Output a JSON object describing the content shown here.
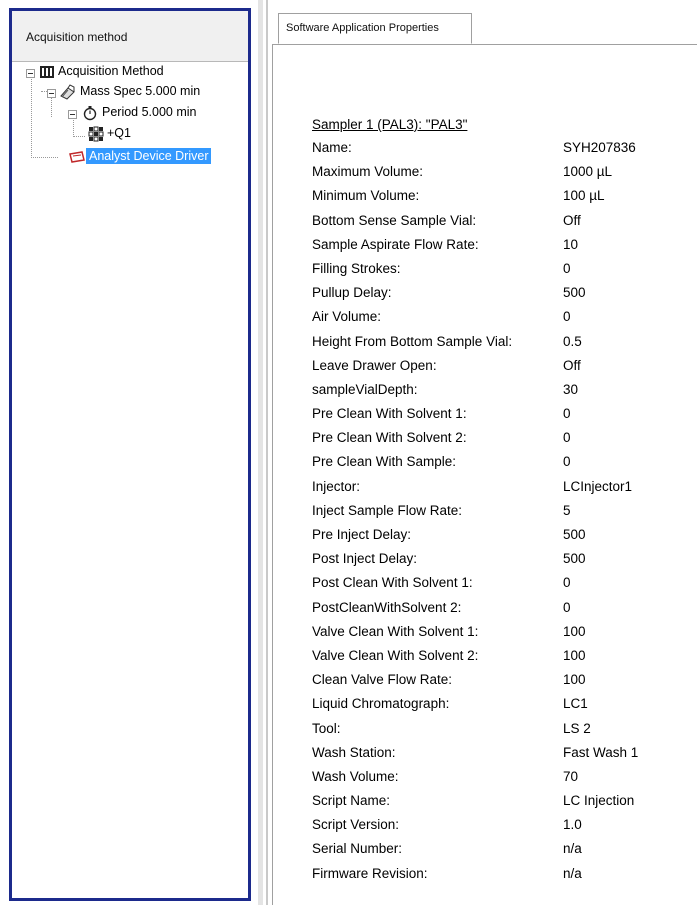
{
  "left_panel": {
    "header": "Acquisition method",
    "tree": {
      "root": "Acquisition Method",
      "mass_spec": "Mass Spec  5.000 min",
      "period": "Period  5.000 min",
      "q1": "+Q1",
      "driver": "Analyst Device Driver"
    }
  },
  "right_panel": {
    "tab_label": "Software Application Properties",
    "section_title": "Sampler 1 (PAL3): \"PAL3\"",
    "properties": [
      {
        "name": "Name:",
        "value": "SYH207836"
      },
      {
        "name": "Maximum Volume:",
        "value": "1000 µL"
      },
      {
        "name": "Minimum Volume:",
        "value": "100 µL"
      },
      {
        "name": "Bottom Sense Sample Vial:",
        "value": "Off"
      },
      {
        "name": "Sample Aspirate Flow Rate:",
        "value": "10"
      },
      {
        "name": "Filling Strokes:",
        "value": "0"
      },
      {
        "name": "Pullup Delay:",
        "value": "500"
      },
      {
        "name": "Air Volume:",
        "value": "0"
      },
      {
        "name": "Height From Bottom Sample Vial:",
        "value": "0.5"
      },
      {
        "name": "Leave Drawer Open:",
        "value": "Off"
      },
      {
        "name": "sampleVialDepth:",
        "value": "30"
      },
      {
        "name": "Pre Clean With Solvent 1:",
        "value": "0"
      },
      {
        "name": "Pre Clean With Solvent 2:",
        "value": "0"
      },
      {
        "name": "Pre Clean With Sample:",
        "value": "0"
      },
      {
        "name": "Injector:",
        "value": "LCInjector1"
      },
      {
        "name": "Inject Sample Flow Rate:",
        "value": "5"
      },
      {
        "name": "Pre Inject Delay:",
        "value": "500"
      },
      {
        "name": "Post Inject Delay:",
        "value": "500"
      },
      {
        "name": "Post Clean With Solvent 1:",
        "value": "0"
      },
      {
        "name": "PostCleanWithSolvent 2:",
        "value": "0"
      },
      {
        "name": "Valve Clean With Solvent 1:",
        "value": "100"
      },
      {
        "name": "Valve Clean With Solvent 2:",
        "value": "100"
      },
      {
        "name": "Clean Valve Flow Rate:",
        "value": "100"
      },
      {
        "name": "Liquid Chromatograph:",
        "value": "LC1"
      },
      {
        "name": "Tool:",
        "value": "LS 2"
      },
      {
        "name": "Wash Station:",
        "value": "Fast Wash 1"
      },
      {
        "name": "Wash Volume:",
        "value": "70"
      },
      {
        "name": "Script Name:",
        "value": "LC Injection"
      },
      {
        "name": "Script Version:",
        "value": "1.0"
      },
      {
        "name": "Serial Number:",
        "value": "n/a"
      },
      {
        "name": "Firmware Revision:",
        "value": "n/a"
      }
    ]
  },
  "colors": {
    "left_border": "#1c2a8c",
    "selection": "#3399ff"
  },
  "icons": {
    "root": "method-book-icon",
    "mass_spec": "mass-spec-icon",
    "period": "stopwatch-icon",
    "q1": "scan-grid-icon",
    "driver": "device-driver-icon"
  }
}
